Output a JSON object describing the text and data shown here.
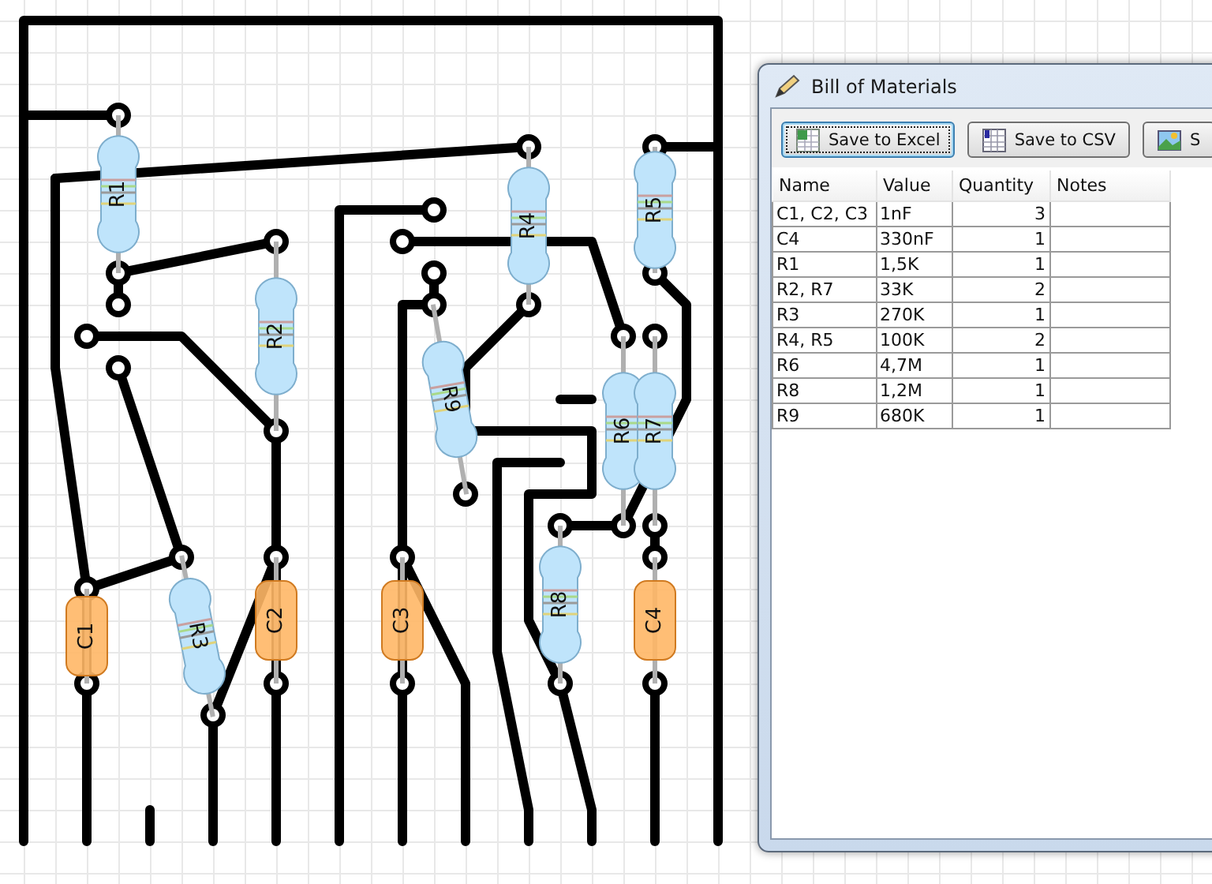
{
  "canvas": {
    "components": [
      {
        "label": "R1",
        "kind": "resistor"
      },
      {
        "label": "R2",
        "kind": "resistor"
      },
      {
        "label": "R3",
        "kind": "resistor"
      },
      {
        "label": "R4",
        "kind": "resistor"
      },
      {
        "label": "R5",
        "kind": "resistor"
      },
      {
        "label": "R6",
        "kind": "resistor"
      },
      {
        "label": "R7",
        "kind": "resistor"
      },
      {
        "label": "R8",
        "kind": "resistor"
      },
      {
        "label": "R9",
        "kind": "resistor"
      },
      {
        "label": "C1",
        "kind": "capacitor"
      },
      {
        "label": "C2",
        "kind": "capacitor"
      },
      {
        "label": "C3",
        "kind": "capacitor"
      },
      {
        "label": "C4",
        "kind": "capacitor"
      }
    ]
  },
  "dialog": {
    "title": "Bill of Materials",
    "buttons": [
      {
        "label": "Save to Excel",
        "kind": "excel",
        "focused": true
      },
      {
        "label": "Save to CSV",
        "kind": "csv",
        "focused": false
      },
      {
        "label": "S",
        "kind": "image",
        "focused": false
      }
    ],
    "table": {
      "columns": [
        "Name",
        "Value",
        "Quantity",
        "Notes"
      ],
      "rows": [
        [
          "C1, C2, C3",
          "1nF",
          "3",
          ""
        ],
        [
          "C4",
          "330nF",
          "1",
          ""
        ],
        [
          "R1",
          "1,5K",
          "1",
          ""
        ],
        [
          "R2, R7",
          "33K",
          "2",
          ""
        ],
        [
          "R3",
          "270K",
          "1",
          ""
        ],
        [
          "R4, R5",
          "100K",
          "2",
          ""
        ],
        [
          "R6",
          "4,7M",
          "1",
          ""
        ],
        [
          "R8",
          "1,2M",
          "1",
          ""
        ],
        [
          "R9",
          "680K",
          "1",
          ""
        ]
      ]
    }
  }
}
